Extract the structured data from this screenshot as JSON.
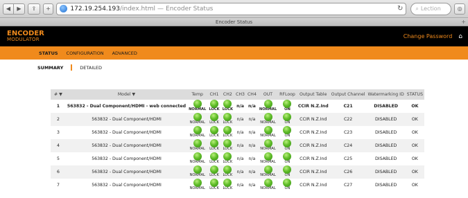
{
  "browser": {
    "url_host": "172.19.254.193",
    "url_path": "/index.html",
    "url_separator": "—",
    "page_title": "Encoder Status",
    "tab_title": "Encoder Status",
    "search_placeholder": "Lection"
  },
  "app": {
    "logo_line1": "ENCODER",
    "logo_line2": "MODULATOR",
    "change_password": "Change Password",
    "nav": [
      "STATUS",
      "CONFIGURATION",
      "ADVANCED"
    ],
    "subnav_summary": "SUMMARY",
    "subnav_detailed": "DETAILED"
  },
  "table": {
    "headers": {
      "num": "# ▼",
      "model": "Model ▼",
      "temp": "Temp",
      "ch1": "CH1",
      "ch2": "CH2",
      "ch3": "CH3",
      "ch4": "CH4",
      "out": "OUT",
      "rfloop": "RFLoop",
      "output_table": "Output Table",
      "output_channel": "Output Channel",
      "watermarking": "Watermarking ID",
      "status": "STATUS"
    },
    "rows": [
      {
        "num": "1",
        "model": "563832 - Dual Component/HDMI - web connected",
        "temp": "NORMAL",
        "ch1": "LOCK",
        "ch2": "LOCK",
        "ch3": "n/a",
        "ch4": "n/a",
        "out": "NORMAL",
        "rfloop": "ON",
        "output_table": "CCIR N.Z.Ind",
        "output_channel": "C21",
        "watermarking": "DISABLED",
        "status": "OK"
      },
      {
        "num": "2",
        "model": "563832 - Dual Component/HDMI",
        "temp": "NORMAL",
        "ch1": "LOCK",
        "ch2": "LOCK",
        "ch3": "n/a",
        "ch4": "n/a",
        "out": "NORMAL",
        "rfloop": "ON",
        "output_table": "CCIR N.Z.Ind",
        "output_channel": "C22",
        "watermarking": "DISABLED",
        "status": "OK"
      },
      {
        "num": "3",
        "model": "563832 - Dual Component/HDMI",
        "temp": "NORMAL",
        "ch1": "LOCK",
        "ch2": "LOCK",
        "ch3": "n/a",
        "ch4": "n/a",
        "out": "NORMAL",
        "rfloop": "ON",
        "output_table": "CCIR N.Z.Ind",
        "output_channel": "C23",
        "watermarking": "DISABLED",
        "status": "OK"
      },
      {
        "num": "4",
        "model": "563832 - Dual Component/HDMI",
        "temp": "NORMAL",
        "ch1": "LOCK",
        "ch2": "LOCK",
        "ch3": "n/a",
        "ch4": "n/a",
        "out": "NORMAL",
        "rfloop": "ON",
        "output_table": "CCIR N.Z.Ind",
        "output_channel": "C24",
        "watermarking": "DISABLED",
        "status": "OK"
      },
      {
        "num": "5",
        "model": "563832 - Dual Component/HDMI",
        "temp": "NORMAL",
        "ch1": "LOCK",
        "ch2": "LOCK",
        "ch3": "n/a",
        "ch4": "n/a",
        "out": "NORMAL",
        "rfloop": "ON",
        "output_table": "CCIR N.Z.Ind",
        "output_channel": "C25",
        "watermarking": "DISABLED",
        "status": "OK"
      },
      {
        "num": "6",
        "model": "563832 - Dual Component/HDMI",
        "temp": "NORMAL",
        "ch1": "LOCK",
        "ch2": "LOCK",
        "ch3": "n/a",
        "ch4": "n/a",
        "out": "NORMAL",
        "rfloop": "ON",
        "output_table": "CCIR N.Z.Ind",
        "output_channel": "C26",
        "watermarking": "DISABLED",
        "status": "OK"
      },
      {
        "num": "7",
        "model": "563832 - Dual Component/HDMI",
        "temp": "NORMAL",
        "ch1": "LOCK",
        "ch2": "LOCK",
        "ch3": "n/a",
        "ch4": "n/a",
        "out": "NORMAL",
        "rfloop": "ON",
        "output_table": "CCIR N.Z.Ind",
        "output_channel": "C27",
        "watermarking": "DISABLED",
        "status": "OK"
      }
    ]
  },
  "icons": {
    "back": "back-icon",
    "forward": "forward-icon",
    "share": "share-icon",
    "add": "add-bookmark-icon",
    "globe": "globe-icon",
    "reload": "reload-icon",
    "reader": "reader-icon",
    "home": "home-icon",
    "led": "status-led-icon"
  },
  "colors": {
    "accent": "#f08a1c",
    "header_bg": "#000000",
    "led_green": "#62be2a"
  }
}
